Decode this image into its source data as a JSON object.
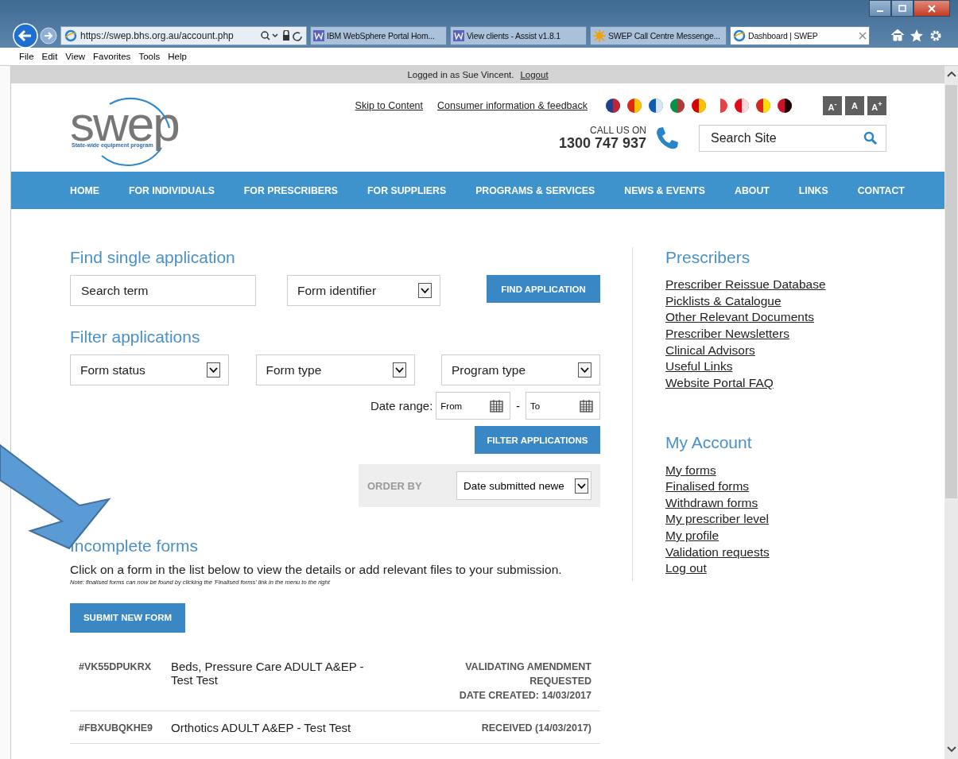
{
  "browser": {
    "address": "https://swep.bhs.org.au/account.php",
    "tabs": [
      {
        "title": "IBM WebSphere Portal Hom...",
        "selected": false,
        "kind": "w"
      },
      {
        "title": "View clients - Assist v1.8.1",
        "selected": false,
        "kind": "w"
      },
      {
        "title": "SWEP Call Centre Messenge...",
        "selected": false,
        "kind": "sun"
      },
      {
        "title": "Dashboard | SWEP",
        "selected": true,
        "kind": "ie"
      }
    ],
    "menu": [
      "File",
      "Edit",
      "View",
      "Favorites",
      "Tools",
      "Help"
    ]
  },
  "login_bar": {
    "text": "Logged in as Sue Vincent.",
    "link": "Logout"
  },
  "header": {
    "logo": "swep",
    "tagline": "State-wide equipment program",
    "links": [
      "Skip to Content",
      "Consumer information & feedback"
    ],
    "font_sizes": [
      "A$^{-}$",
      "A",
      "A$^{+}$"
    ],
    "call_label": "CALL US ON",
    "phone": "1300 747 937",
    "search": {
      "placeholder": "Search Site"
    }
  },
  "nav": [
    "HOME",
    "FOR INDIVIDUALS",
    "FOR PRESCRIBERS",
    "FOR SUPPLIERS",
    "PROGRAMS & SERVICES",
    "NEWS & EVENTS",
    "ABOUT",
    "LINKS",
    "CONTACT"
  ],
  "find": {
    "title": "Find single application",
    "search_placeholder": "Search term",
    "select": "Form identifier",
    "button": "FIND APPLICATION"
  },
  "filter": {
    "title": "Filter applications",
    "selects": [
      "Form status",
      "Form type",
      "Program type"
    ],
    "date_label": "Date range:",
    "from": "From",
    "to": "To",
    "separator": "-",
    "button": "FILTER APPLICATIONS"
  },
  "order": {
    "label": "ORDER BY",
    "value": "Date submitted newe"
  },
  "incomplete": {
    "title": "Incomplete forms",
    "intro": "Click on a form in the list below to view the details or add relevant files to your submission.",
    "note": "Note: finalised forms can now be found by clicking the 'Finalised forms' link in the menu to the right",
    "button": "SUBMIT NEW FORM",
    "forms": [
      {
        "id": "#VK55DPUKRX",
        "title": "Beds, Pressure Care ADULT A&EP - Test Test",
        "status": "VALIDATING AMENDMENT REQUESTED",
        "created": "DATE CREATED: 14/03/2017"
      },
      {
        "id": "#FBXUBQKHE9",
        "title": "Orthotics ADULT A&EP - Test Test",
        "status": "RECEIVED (14/03/2017)"
      }
    ]
  },
  "sidebar": [
    {
      "title": "Prescribers",
      "links": [
        "Prescriber Reissue Database",
        "Picklists & Catalogue",
        "Other Relevant Documents",
        "Prescriber Newsletters",
        "Clinical Advisors",
        "Useful Links",
        "Website Portal FAQ"
      ]
    },
    {
      "title": "My Account",
      "links": [
        "My forms",
        "Finalised forms",
        "Withdrawn forms",
        "My prescriber level",
        "My profile",
        "Validation requests",
        "Log out"
      ]
    }
  ]
}
